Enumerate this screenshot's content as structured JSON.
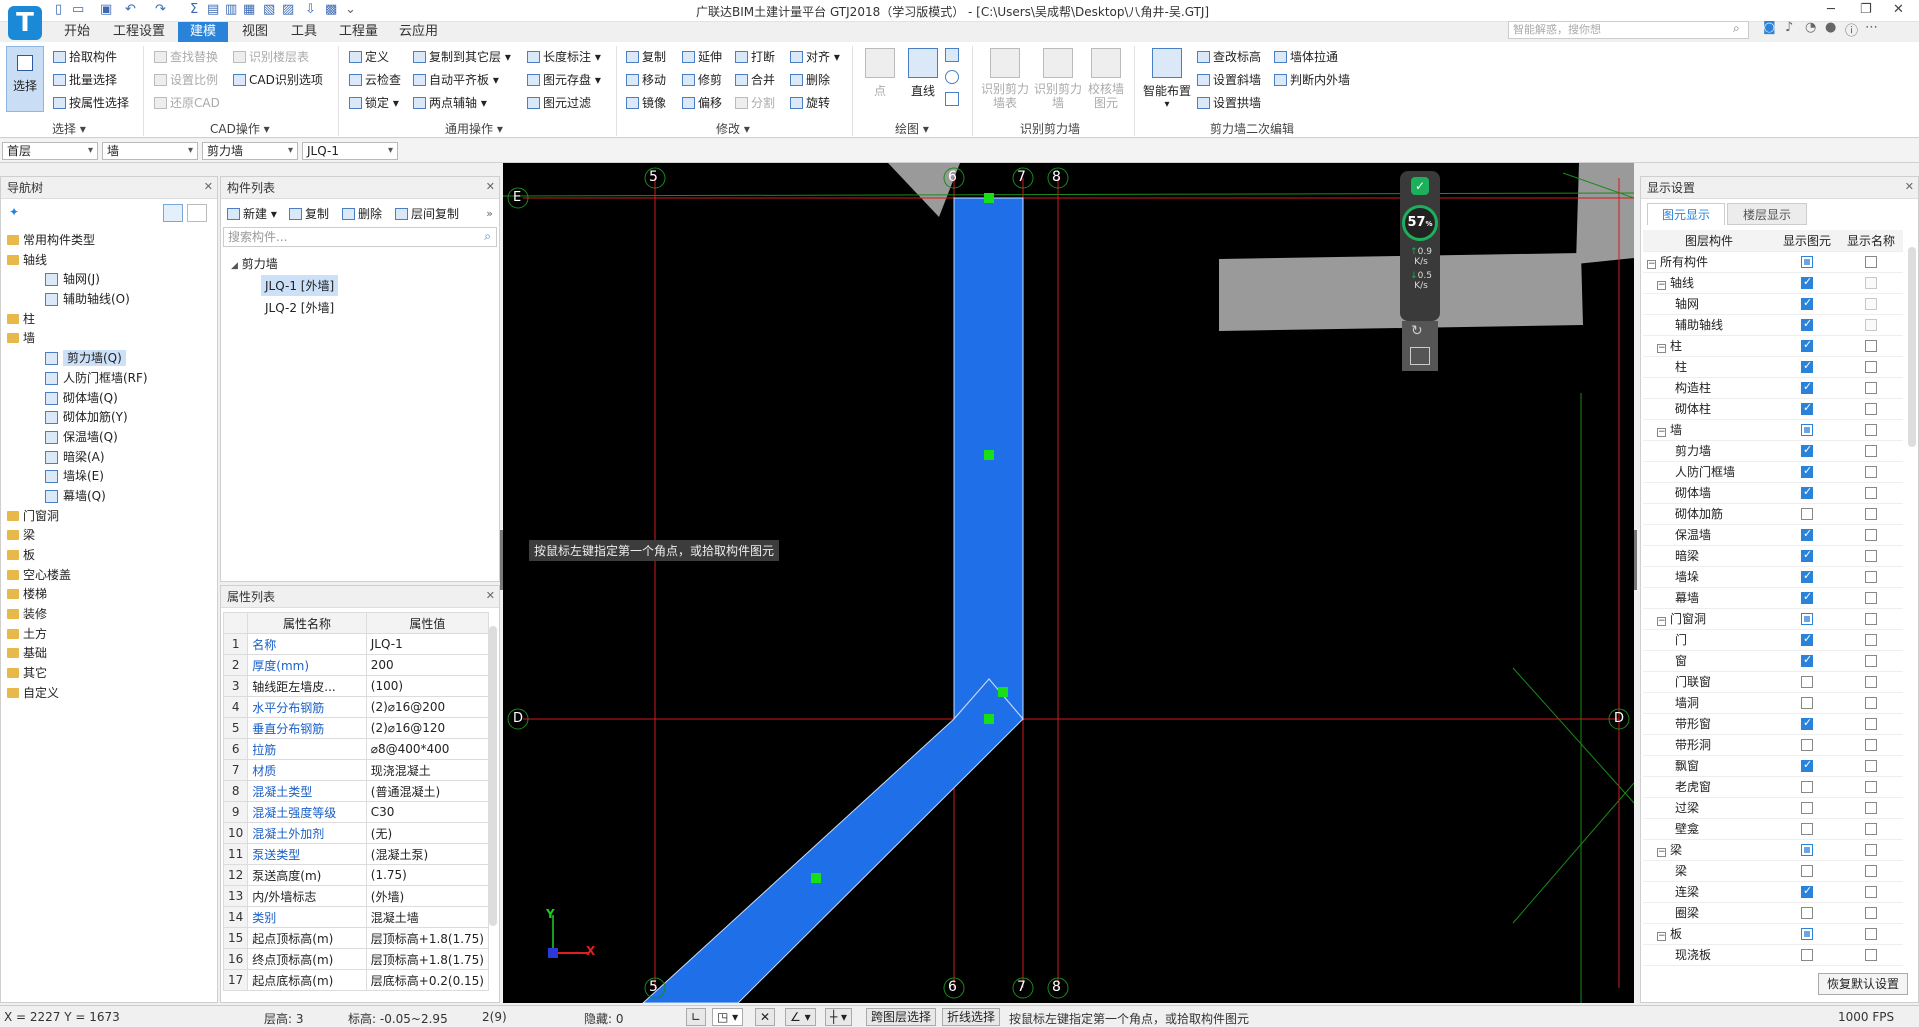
{
  "app": {
    "logo_letter": "T",
    "title": "广联达BIM土建计量平台 GTJ2018（学习版模式） - [C:\\Users\\吴成帮\\Desktop\\八角井-吴.GTJ]",
    "search_placeholder": "智能解惑，搜你想",
    "accent_color": "#2b83d9"
  },
  "menu": [
    "开始",
    "工程设置",
    "建模",
    "视图",
    "工具",
    "工程量",
    "云应用"
  ],
  "menu_active": "建模",
  "ribbon": {
    "select_big": "选择",
    "select_items": [
      "拾取构件",
      "批量选择",
      "按属性选择"
    ],
    "select_group": "选择",
    "cad_items": [
      "查找替换",
      "设置比例",
      "还原CAD",
      "识别楼层表",
      "CAD识别选项"
    ],
    "cad_group": "CAD操作",
    "general_items": [
      "定义",
      "云检查",
      "锁定",
      "复制到其它层",
      "自动平齐板",
      "两点辅轴",
      "长度标注",
      "图元存盘",
      "图元过滤"
    ],
    "general_group": "通用操作",
    "modify_items": [
      "复制",
      "移动",
      "镜像",
      "延伸",
      "修剪",
      "偏移",
      "打断",
      "合并",
      "分割",
      "对齐",
      "删除",
      "旋转"
    ],
    "modify_group": "修改",
    "draw_items": [
      "点",
      "直线"
    ],
    "draw_group": "绘图",
    "recog_items": [
      "识别剪力墙表",
      "识别剪力墙",
      "校核墙图元"
    ],
    "recog_group": "识别剪力墙",
    "smart_layout": "智能布置",
    "edit_items": [
      "查改标高",
      "设置斜墙",
      "设置拱墙",
      "墙体拉通",
      "判断内外墙"
    ],
    "edit_group": "剪力墙二次编辑"
  },
  "dropdowns": [
    "首层",
    "墙",
    "剪力墙",
    "JLQ-1"
  ],
  "nav": {
    "title": "导航树",
    "items": [
      {
        "label": "常用构件类型",
        "level": 0
      },
      {
        "label": "轴线",
        "level": 0
      },
      {
        "label": "轴网(J)",
        "level": 1
      },
      {
        "label": "辅助轴线(O)",
        "level": 1
      },
      {
        "label": "柱",
        "level": 0
      },
      {
        "label": "墙",
        "level": 0
      },
      {
        "label": "剪力墙(Q)",
        "level": 1,
        "selected": true
      },
      {
        "label": "人防门框墙(RF)",
        "level": 1
      },
      {
        "label": "砌体墙(Q)",
        "level": 1
      },
      {
        "label": "砌体加筋(Y)",
        "level": 1
      },
      {
        "label": "保温墙(Q)",
        "level": 1
      },
      {
        "label": "暗梁(A)",
        "level": 1
      },
      {
        "label": "墙垛(E)",
        "level": 1
      },
      {
        "label": "幕墙(Q)",
        "level": 1
      },
      {
        "label": "门窗洞",
        "level": 0
      },
      {
        "label": "梁",
        "level": 0
      },
      {
        "label": "板",
        "level": 0
      },
      {
        "label": "空心楼盖",
        "level": 0
      },
      {
        "label": "楼梯",
        "level": 0
      },
      {
        "label": "装修",
        "level": 0
      },
      {
        "label": "土方",
        "level": 0
      },
      {
        "label": "基础",
        "level": 0
      },
      {
        "label": "其它",
        "level": 0
      },
      {
        "label": "自定义",
        "level": 0
      }
    ]
  },
  "component_list": {
    "title": "构件列表",
    "toolbar": [
      "新建",
      "复制",
      "删除",
      "层间复制"
    ],
    "search_placeholder": "搜索构件...",
    "category": "剪力墙",
    "items": [
      "JLQ-1 [外墙]",
      "JLQ-2 [外墙]"
    ],
    "selected": "JLQ-1 [外墙]"
  },
  "properties": {
    "title": "属性列表",
    "col_name": "属性名称",
    "col_value": "属性值",
    "rows": [
      {
        "n": "1",
        "name": "名称",
        "value": "JLQ-1",
        "blue": true
      },
      {
        "n": "2",
        "name": "厚度(mm)",
        "value": "200",
        "blue": true
      },
      {
        "n": "3",
        "name": "轴线距左墙皮...",
        "value": "(100)",
        "blue": false
      },
      {
        "n": "4",
        "name": "水平分布钢筋",
        "value": "(2)⌀16@200",
        "blue": true
      },
      {
        "n": "5",
        "name": "垂直分布钢筋",
        "value": "(2)⌀16@120",
        "blue": true
      },
      {
        "n": "6",
        "name": "拉筋",
        "value": "⌀8@400*400",
        "blue": true
      },
      {
        "n": "7",
        "name": "材质",
        "value": "现浇混凝土",
        "blue": true
      },
      {
        "n": "8",
        "name": "混凝土类型",
        "value": "(普通混凝土)",
        "blue": true
      },
      {
        "n": "9",
        "name": "混凝土强度等级",
        "value": "C30",
        "blue": true
      },
      {
        "n": "10",
        "name": "混凝土外加剂",
        "value": "(无)",
        "blue": true
      },
      {
        "n": "11",
        "name": "泵送类型",
        "value": "(混凝土泵)",
        "blue": true
      },
      {
        "n": "12",
        "name": "泵送高度(m)",
        "value": "(1.75)",
        "blue": false
      },
      {
        "n": "13",
        "name": "内/外墙标志",
        "value": "(外墙)",
        "blue": false
      },
      {
        "n": "14",
        "name": "类别",
        "value": "混凝土墙",
        "blue": true
      },
      {
        "n": "15",
        "name": "起点顶标高(m)",
        "value": "层顶标高+1.8(1.75)",
        "blue": false
      },
      {
        "n": "16",
        "name": "终点顶标高(m)",
        "value": "层顶标高+1.8(1.75)",
        "blue": false
      },
      {
        "n": "17",
        "name": "起点底标高(m)",
        "value": "层底标高+0.2(0.15)",
        "blue": false
      }
    ]
  },
  "canvas": {
    "axis_labels_top": [
      "5",
      "6",
      "7",
      "8"
    ],
    "axis_labels_bottom": [
      "5",
      "6",
      "7",
      "8"
    ],
    "row_labels": [
      "E",
      "D"
    ],
    "tooltip": "按鼠标左键指定第一个角点，或拾取构件图元",
    "wall_color": "#1f6fe8",
    "grid_color": "#d01c1c",
    "speed_percent": "57",
    "speed_up": "0.9",
    "speed_down": "0.5",
    "speed_unit": "K/s",
    "axis_x": "X",
    "axis_y": "Y"
  },
  "display": {
    "title": "显示设置",
    "tabs": [
      "图元显示",
      "楼层显示"
    ],
    "cols": [
      "图层构件",
      "显示图元",
      "显示名称"
    ],
    "rows": [
      {
        "label": "所有构件",
        "level": 0,
        "exp": "−",
        "show": "part",
        "name": "off"
      },
      {
        "label": "轴线",
        "level": 1,
        "exp": "−",
        "show": "on",
        "name": "dis"
      },
      {
        "label": "轴网",
        "level": 2,
        "show": "on",
        "name": "dis"
      },
      {
        "label": "辅助轴线",
        "level": 2,
        "show": "on",
        "name": "dis"
      },
      {
        "label": "柱",
        "level": 1,
        "exp": "−",
        "show": "on",
        "name": "off"
      },
      {
        "label": "柱",
        "level": 2,
        "show": "on",
        "name": "off"
      },
      {
        "label": "构造柱",
        "level": 2,
        "show": "on",
        "name": "off"
      },
      {
        "label": "砌体柱",
        "level": 2,
        "show": "on",
        "name": "off"
      },
      {
        "label": "墙",
        "level": 1,
        "exp": "−",
        "show": "part",
        "name": "off"
      },
      {
        "label": "剪力墙",
        "level": 2,
        "show": "on",
        "name": "off"
      },
      {
        "label": "人防门框墙",
        "level": 2,
        "show": "on",
        "name": "off"
      },
      {
        "label": "砌体墙",
        "level": 2,
        "show": "on",
        "name": "off"
      },
      {
        "label": "砌体加筋",
        "level": 2,
        "show": "off",
        "name": "off"
      },
      {
        "label": "保温墙",
        "level": 2,
        "show": "on",
        "name": "off"
      },
      {
        "label": "暗梁",
        "level": 2,
        "show": "on",
        "name": "off"
      },
      {
        "label": "墙垛",
        "level": 2,
        "show": "on",
        "name": "off"
      },
      {
        "label": "幕墙",
        "level": 2,
        "show": "on",
        "name": "off"
      },
      {
        "label": "门窗洞",
        "level": 1,
        "exp": "−",
        "show": "part",
        "name": "off"
      },
      {
        "label": "门",
        "level": 2,
        "show": "on",
        "name": "off"
      },
      {
        "label": "窗",
        "level": 2,
        "show": "on",
        "name": "off"
      },
      {
        "label": "门联窗",
        "level": 2,
        "show": "off",
        "name": "off"
      },
      {
        "label": "墙洞",
        "level": 2,
        "show": "off",
        "name": "off"
      },
      {
        "label": "带形窗",
        "level": 2,
        "show": "on",
        "name": "off"
      },
      {
        "label": "带形洞",
        "level": 2,
        "show": "off",
        "name": "off"
      },
      {
        "label": "飘窗",
        "level": 2,
        "show": "on",
        "name": "off"
      },
      {
        "label": "老虎窗",
        "level": 2,
        "show": "off",
        "name": "off"
      },
      {
        "label": "过梁",
        "level": 2,
        "show": "off",
        "name": "off"
      },
      {
        "label": "壁龛",
        "level": 2,
        "show": "off",
        "name": "off"
      },
      {
        "label": "梁",
        "level": 1,
        "exp": "−",
        "show": "part",
        "name": "off"
      },
      {
        "label": "梁",
        "level": 2,
        "show": "off",
        "name": "off"
      },
      {
        "label": "连梁",
        "level": 2,
        "show": "on",
        "name": "off"
      },
      {
        "label": "圈梁",
        "level": 2,
        "show": "off",
        "name": "off"
      },
      {
        "label": "板",
        "level": 1,
        "exp": "−",
        "show": "part",
        "name": "off"
      },
      {
        "label": "现浇板",
        "level": 2,
        "show": "off",
        "name": "off"
      }
    ],
    "restore_button": "恢复默认设置"
  },
  "status": {
    "coords": "X = 2227 Y = 1673",
    "floor_height_label": "层高:",
    "floor_height": "3",
    "elev_label": "标高:",
    "elev": "-0.05~2.95",
    "count": "2(9)",
    "hidden_label": "隐藏:",
    "hidden": "0",
    "btn_cross_floor": "跨图层选择",
    "btn_polyline": "折线选择",
    "hint": "按鼠标左键指定第一个角点，或拾取构件图元",
    "fps": "1000 FPS"
  }
}
